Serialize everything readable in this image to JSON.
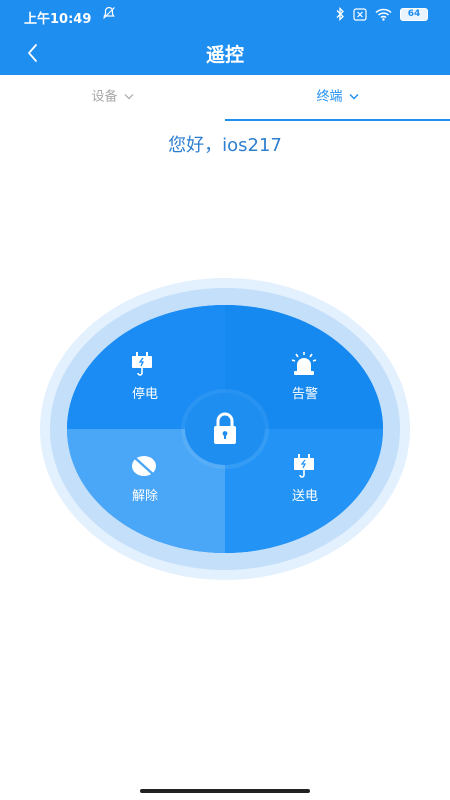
{
  "status_bar": {
    "time": "上午10:49",
    "battery": "64"
  },
  "header": {
    "title": "遥控"
  },
  "tabs": [
    {
      "label": "设备",
      "active": false
    },
    {
      "label": "终端",
      "active": true
    }
  ],
  "greeting": "您好，ios217",
  "controls": {
    "power_off_label": "停电",
    "alarm_label": "告警",
    "release_label": "解除",
    "power_on_label": "送电"
  },
  "colors": {
    "primary": "#1f8ef1",
    "greeting_text": "#2e7fd0",
    "inactive_tab": "#a8a8a8"
  }
}
